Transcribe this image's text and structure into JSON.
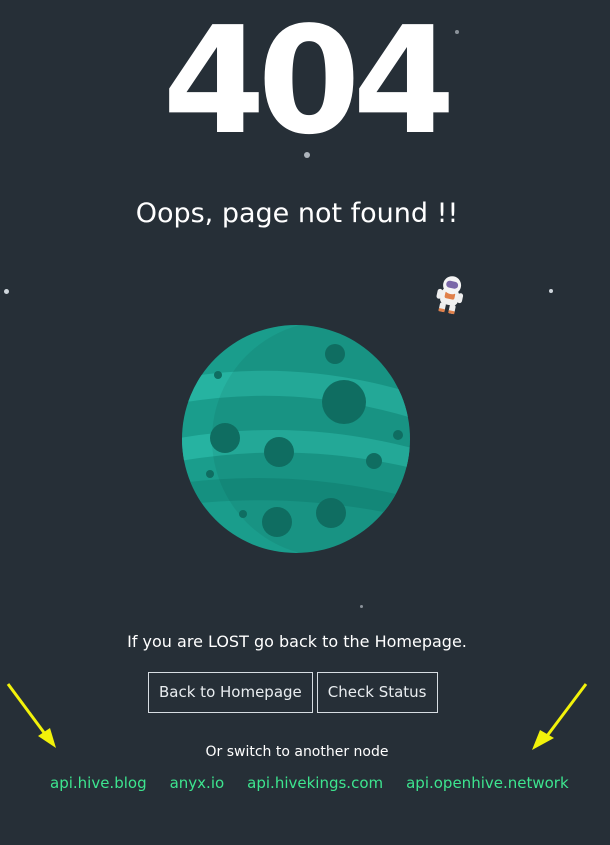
{
  "error_code": "404",
  "title": "Oops, page not found !!",
  "lost_message": "If you are LOST go back to the Homepage.",
  "buttons": {
    "back_home": "Back to Homepage",
    "check_status": "Check Status"
  },
  "switch_message": "Or switch to another node",
  "nodes": [
    "api.hive.blog",
    "anyx.io",
    "api.hivekings.com",
    "api.openhive.network"
  ],
  "colors": {
    "background": "#262f37",
    "link": "#3de58f",
    "planet": "#1a9d8c",
    "arrow": "#f2f20a"
  }
}
